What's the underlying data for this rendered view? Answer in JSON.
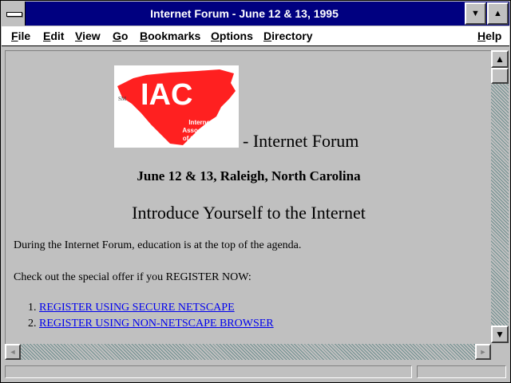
{
  "window": {
    "title": "Internet Forum - June 12 & 13, 1995",
    "minimize_glyph": "▼",
    "maximize_glyph": "▲"
  },
  "menu": [
    {
      "label": "File",
      "accel": "F"
    },
    {
      "label": "Edit",
      "accel": "E"
    },
    {
      "label": "View",
      "accel": "V"
    },
    {
      "label": "Go",
      "accel": "G"
    },
    {
      "label": "Bookmarks",
      "accel": "B"
    },
    {
      "label": "Options",
      "accel": "O"
    },
    {
      "label": "Directory",
      "accel": "D"
    },
    {
      "label": "Help",
      "accel": "H"
    }
  ],
  "page": {
    "logo": {
      "letters": "IAC",
      "mark": "SM",
      "lines": [
        "Internet",
        "Association",
        "of the Carolinas"
      ],
      "color": "#ff2020"
    },
    "forum_suffix": "- Internet Forum",
    "dates": "June 12 & 13, Raleigh, North Carolina",
    "heading": "Introduce Yourself to the Internet",
    "para1": "During the Internet Forum, education is at the top of the agenda.",
    "para2": "Check out the special offer if you REGISTER NOW:",
    "links": [
      {
        "num": "1.",
        "text": "REGISTER USING SECURE NETSCAPE"
      },
      {
        "num": "2.",
        "text": "REGISTER USING NON-NETSCAPE BROWSER"
      }
    ]
  },
  "scroll": {
    "up_arrow": "▲",
    "down_arrow": "▼",
    "left_arrow": "◄",
    "right_arrow": "►"
  }
}
